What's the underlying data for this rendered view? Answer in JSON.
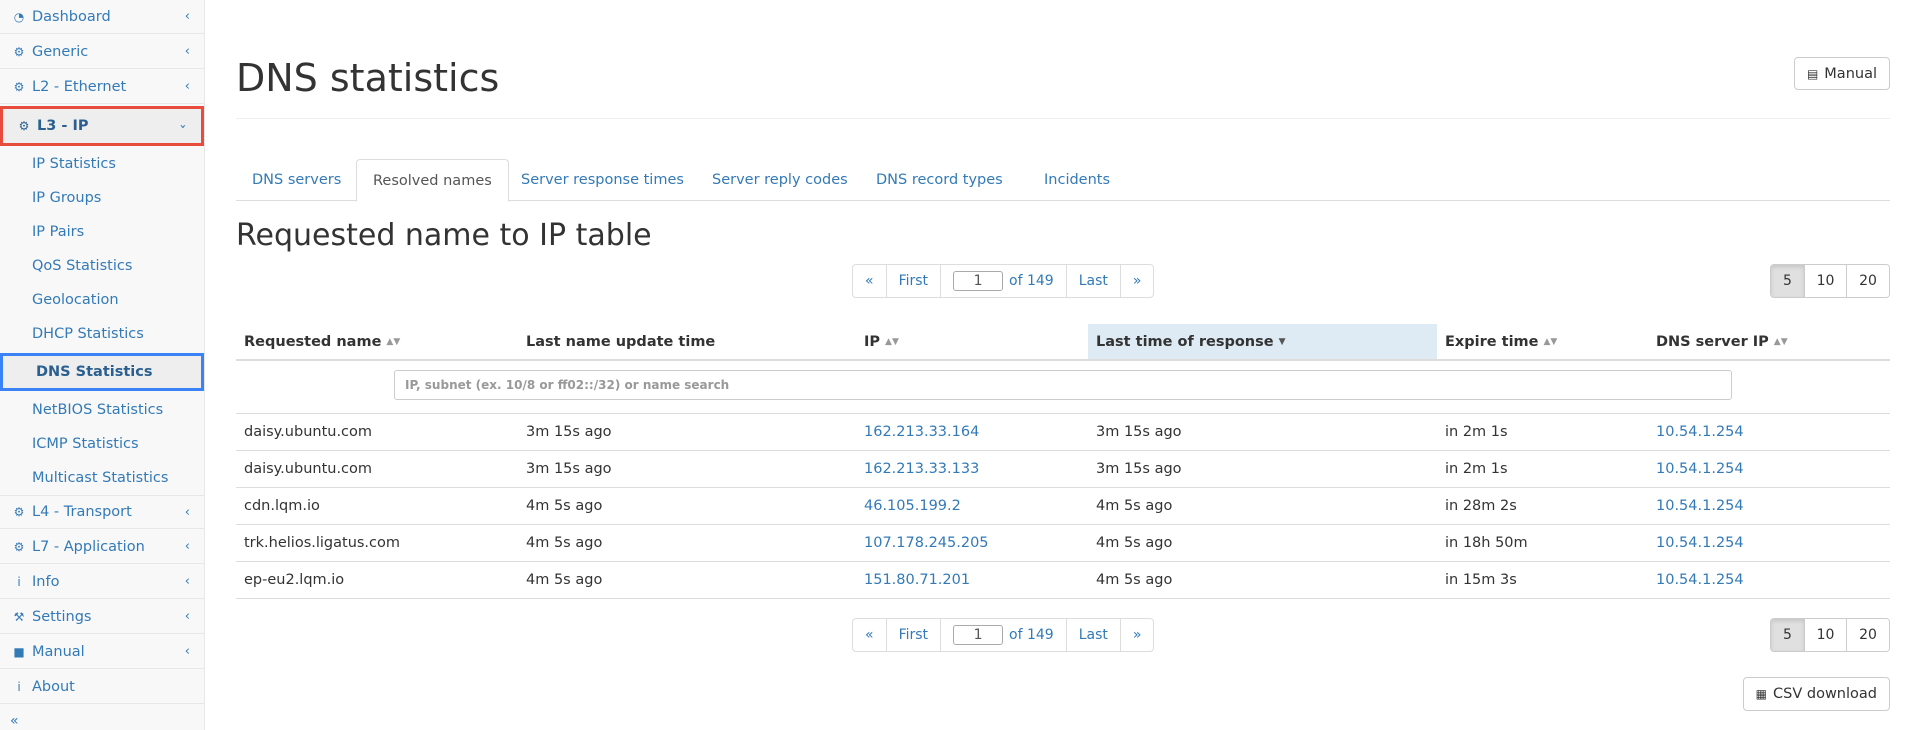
{
  "sidebar": {
    "items": [
      {
        "label": "Dashboard",
        "icon": "dashboard-icon",
        "glyph": "◔"
      },
      {
        "label": "Generic",
        "icon": "gear-icon",
        "glyph": "⚙"
      },
      {
        "label": "L2 - Ethernet",
        "icon": "gear-icon",
        "glyph": "⚙"
      },
      {
        "label": "L3 - IP",
        "icon": "gear-icon",
        "glyph": "⚙"
      },
      {
        "label": "L4 - Transport",
        "icon": "gear-icon",
        "glyph": "⚙"
      },
      {
        "label": "L7 - Application",
        "icon": "gear-icon",
        "glyph": "⚙"
      },
      {
        "label": "Info",
        "icon": "info-icon",
        "glyph": "i"
      },
      {
        "label": "Settings",
        "icon": "wrench-icon",
        "glyph": "⚒"
      },
      {
        "label": "Manual",
        "icon": "book-icon",
        "glyph": "■"
      },
      {
        "label": "About",
        "icon": "info-icon",
        "glyph": "i"
      }
    ],
    "subitems": [
      "IP Statistics",
      "IP Groups",
      "IP Pairs",
      "QoS Statistics",
      "Geolocation",
      "DHCP Statistics",
      "DNS Statistics",
      "NetBIOS Statistics",
      "ICMP Statistics",
      "Multicast Statistics"
    ],
    "chevron": "‹",
    "collapse": "«"
  },
  "header": {
    "title": "DNS statistics",
    "manual_label": "Manual"
  },
  "tabs": [
    "DNS servers",
    "Resolved names",
    "Server response times",
    "Server reply codes",
    "DNS record types",
    "Incidents"
  ],
  "section_title": "Requested name to IP table",
  "pager": {
    "prev": "«",
    "first": "First",
    "current": "1",
    "of_text": "of 149",
    "last": "Last",
    "next": "»"
  },
  "per_page": [
    "5",
    "10",
    "20"
  ],
  "table": {
    "columns": [
      "Requested name",
      "Last name update time",
      "IP",
      "Last time of response",
      "Expire time",
      "DNS server IP"
    ],
    "filter_placeholder": "IP, subnet (ex. 10/8 or ff02::/32) or name search",
    "rows": [
      [
        "daisy.ubuntu.com",
        "3m 15s ago",
        "162.213.33.164",
        "3m 15s ago",
        "in 2m 1s",
        "10.54.1.254"
      ],
      [
        "daisy.ubuntu.com",
        "3m 15s ago",
        "162.213.33.133",
        "3m 15s ago",
        "in 2m 1s",
        "10.54.1.254"
      ],
      [
        "cdn.lqm.io",
        "4m 5s ago",
        "46.105.199.2",
        "4m 5s ago",
        "in 28m 2s",
        "10.54.1.254"
      ],
      [
        "trk.helios.ligatus.com",
        "4m 5s ago",
        "107.178.245.205",
        "4m 5s ago",
        "in 18h 50m",
        "10.54.1.254"
      ],
      [
        "ep-eu2.lqm.io",
        "4m 5s ago",
        "151.80.71.201",
        "4m 5s ago",
        "in 15m 3s",
        "10.54.1.254"
      ]
    ]
  },
  "csv_label": "CSV download",
  "colors": {
    "link": "#337ab7",
    "active_border": "#e74c3c",
    "selected_border": "#3b82f6",
    "sorted_header": "#deebf5"
  }
}
